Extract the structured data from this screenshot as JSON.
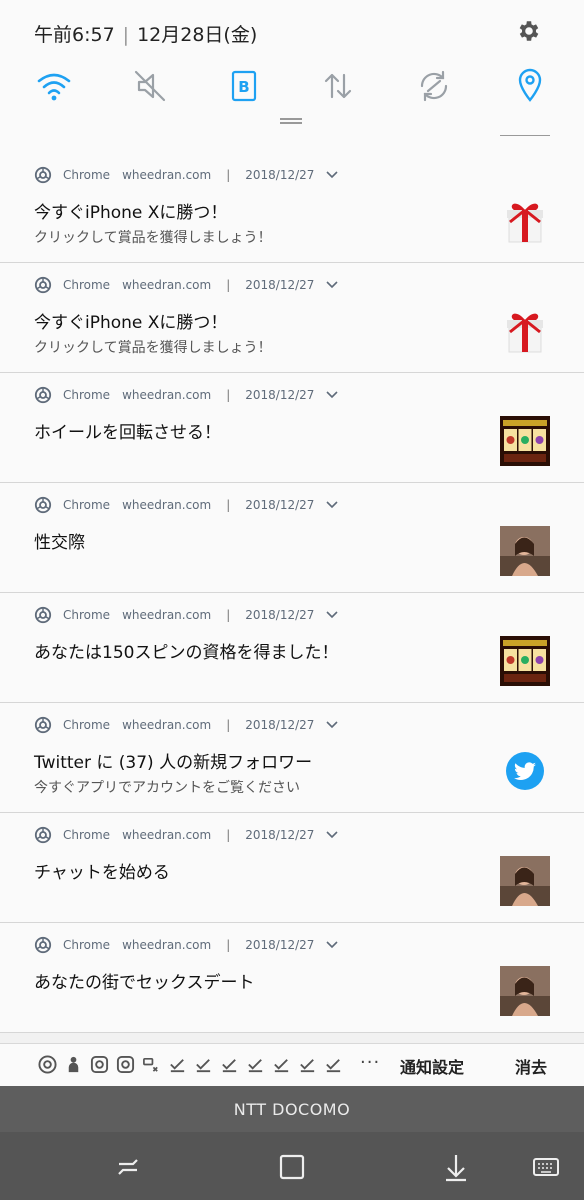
{
  "status_bar": {
    "time": "午前6:57",
    "date": "12月28日(金)",
    "accent_color": "#1ea1f2",
    "quick_settings": [
      "wifi-icon",
      "mute-icon",
      "bluetooth-icon",
      "data-icon",
      "sync-icon",
      "location-icon"
    ]
  },
  "notifications": [
    {
      "app": "Chrome",
      "site": "wheedran.com",
      "date": "2018/12/27",
      "title": "今すぐiPhone Xに勝つ！",
      "body": "クリックして賞品を獲得しましょう！",
      "thumb": "gift-icon"
    },
    {
      "app": "Chrome",
      "site": "wheedran.com",
      "date": "2018/12/27",
      "title": "今すぐiPhone Xに勝つ！",
      "body": "クリックして賞品を獲得しましょう！",
      "thumb": "gift-icon"
    },
    {
      "app": "Chrome",
      "site": "wheedran.com",
      "date": "2018/12/27",
      "title": "ホイールを回転させる！",
      "body": "",
      "thumb": "slot-machine-image"
    },
    {
      "app": "Chrome",
      "site": "wheedran.com",
      "date": "2018/12/27",
      "title": "性交際",
      "body": "",
      "thumb": "photo-image"
    },
    {
      "app": "Chrome",
      "site": "wheedran.com",
      "date": "2018/12/27",
      "title": "あなたは150スピンの資格を得ました！",
      "body": "",
      "thumb": "slot-machine-image"
    },
    {
      "app": "Chrome",
      "site": "wheedran.com",
      "date": "2018/12/27",
      "title": "Twitter に (37) 人の新規フォロワー",
      "body": "今すぐアプリでアカウントをご覧ください",
      "thumb": "twitter-icon"
    },
    {
      "app": "Chrome",
      "site": "wheedran.com",
      "date": "2018/12/27",
      "title": "チャットを始める",
      "body": "",
      "thumb": "photo-image"
    },
    {
      "app": "Chrome",
      "site": "wheedran.com",
      "date": "2018/12/27",
      "title": "あなたの街でセックスデート",
      "body": "",
      "thumb": "photo-image"
    }
  ],
  "footer": {
    "dots": "···",
    "settings_label": "通知設定",
    "clear_label": "消去"
  },
  "carrier": "NTT DOCOMO",
  "nav_bar": [
    "recent-apps-icon",
    "home-icon",
    "back-icon",
    "keyboard-icon"
  ]
}
